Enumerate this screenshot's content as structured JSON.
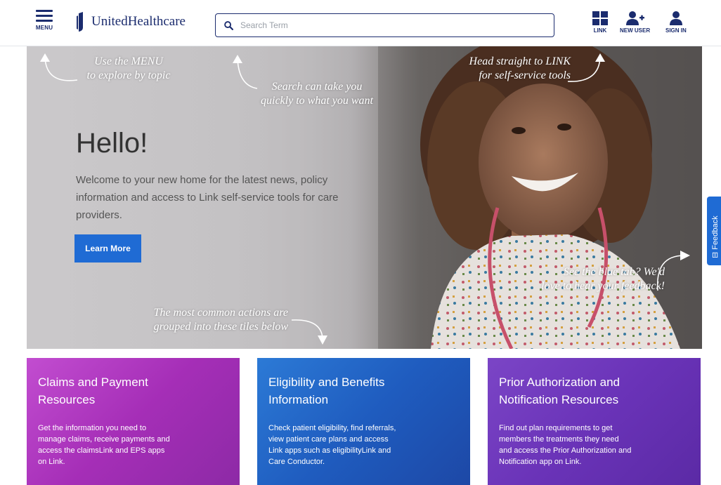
{
  "header": {
    "menu_label": "MENU",
    "logo_text": "UnitedHealthcare",
    "search_placeholder": "Search Term",
    "actions": [
      {
        "label": "LINK",
        "icon": "grid-icon"
      },
      {
        "label": "NEW USER",
        "icon": "add-user-icon"
      },
      {
        "label": "SIGN IN",
        "icon": "user-icon"
      }
    ]
  },
  "hero": {
    "title": "Hello!",
    "welcome": "Welcome to your new home for the latest news, policy information and access to Link self-service tools for care providers.",
    "button_label": "Learn More",
    "annotations": {
      "menu_line1": "Use the MENU",
      "menu_line2": "to explore by topic",
      "search_line1": "Search can take you",
      "search_line2": "quickly to what you want",
      "link_line1": "Head straight to LINK",
      "link_line2": "for self-service tools",
      "feedback_line1": "See the blue tab? We'd",
      "feedback_line2": "love to hear your feedback!",
      "tiles_line1": "The most common actions are",
      "tiles_line2": "grouped into these tiles below"
    }
  },
  "feedback_tab": {
    "label": "Feedback"
  },
  "tiles": [
    {
      "title_line1": "Claims and Payment",
      "title_line2": "Resources",
      "body_line1": "Get the information you need to",
      "body_line2": "manage claims, receive payments and",
      "body_line3": "access the claimsLink and EPS apps",
      "body_line4": "on Link."
    },
    {
      "title_line1": "Eligibility and Benefits",
      "title_line2": "Information",
      "body_line1": "Check patient eligibility, find referrals,",
      "body_line2": "view patient care plans and access",
      "body_line3": "Link apps such as eligibilityLink and",
      "body_line4": "Care Conductor."
    },
    {
      "title_line1": "Prior Authorization and",
      "title_line2": "Notification Resources",
      "body_line1": "Find out plan requirements to get",
      "body_line2": "members the treatments they need",
      "body_line3": "and access the Prior Authorization and",
      "body_line4": "Notification app on Link."
    }
  ],
  "colors": {
    "brand_navy": "#1b2c6e",
    "cta_blue": "#1f6bd4",
    "tile_magenta": "#a52eb7",
    "tile_blue": "#1f5cbf",
    "tile_purple": "#6a33b8"
  }
}
